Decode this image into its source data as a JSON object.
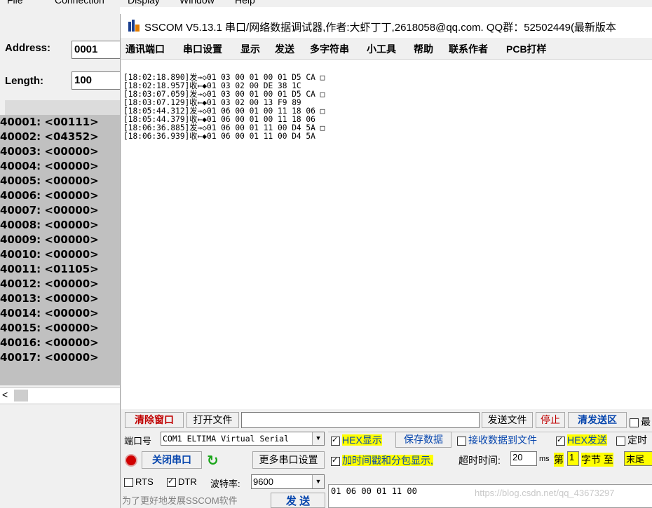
{
  "bg_app": {
    "menu": [
      "File",
      "Connection",
      "Display",
      "Window",
      "Help"
    ],
    "address_label": "Address:",
    "address_value": "0001",
    "length_label": "Length:",
    "length_value": "100",
    "registers": [
      "40001: <00111>",
      "40002: <04352>",
      "40003: <00000>",
      "40004: <00000>",
      "40005: <00000>",
      "40006: <00000>",
      "40007: <00000>",
      "40008: <00000>",
      "40009: <00000>",
      "40010: <00000>",
      "40011: <01105>",
      "40012: <00000>",
      "40013: <00000>",
      "40014: <00000>",
      "40015: <00000>",
      "40016: <00000>",
      "40017: <00000>"
    ],
    "scroll_left": "<"
  },
  "sscom": {
    "title": "SSCOM V5.13.1 串口/网络数据调试器,作者:大虾丁丁,2618058@qq.com. QQ群：52502449(最新版本",
    "menu": [
      "通讯端口",
      "串口设置",
      "显示",
      "发送",
      "多字符串",
      "小工具",
      "帮助",
      "联系作者",
      "PCB打样"
    ],
    "log": [
      "[18:02:18.890]发→◇01 03 00 01 00 01 D5 CA □",
      "[18:02:18.957]收←◆01 03 02 00 DE 38 1C",
      "[18:03:07.059]发→◇01 03 00 01 00 01 D5 CA □",
      "[18:03:07.129]收←◆01 03 02 00 13 F9 89",
      "[18:05:44.312]发→◇01 06 00 01 00 11 18 06 □",
      "[18:05:44.379]收←◆01 06 00 01 00 11 18 06",
      "[18:06:36.885]发→◇01 06 00 01 11 00 D4 5A □",
      "[18:06:36.939]收←◆01 06 00 01 11 00 D4 5A"
    ],
    "bottom": {
      "clear_window": "清除窗口",
      "open_file": "打开文件",
      "send_file": "发送文件",
      "stop": "停止",
      "clear_send": "清发送区",
      "last": "最",
      "port_label": "端口号",
      "port_value": "COM1 ELTIMA Virtual Serial",
      "hex_display": "HEX显示",
      "save_data": "保存数据",
      "recv_to_file": "接收数据到文件",
      "hex_send": "HEX发送",
      "timed": "定时",
      "close_port": "关闭串口",
      "more_settings": "更多串口设置",
      "timestamp": "加时间戳和分包显示,",
      "timeout_label": "超时时间:",
      "timeout_value": "20",
      "ms": "ms",
      "di": "第",
      "byte_index": "1",
      "byte_label": "字节 至",
      "end": "末尾",
      "rts": "RTS",
      "dtr": "DTR",
      "baud_label": "波特率:",
      "baud_value": "9600",
      "send_data": "01 06 00 01 11 00",
      "promo": "为了更好地发展SSCOM软件",
      "send_btn": "发 送",
      "watermark": "https://blog.csdn.net/qq_43673297"
    }
  }
}
